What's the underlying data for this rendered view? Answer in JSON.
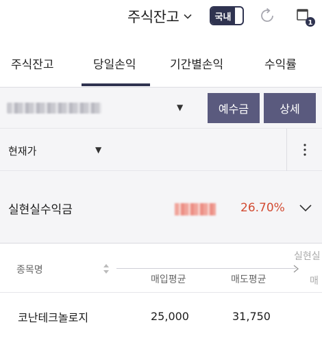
{
  "header": {
    "title": "주식잔고",
    "market_toggle": "국내",
    "badge_count": "1"
  },
  "tabs": [
    {
      "label": "주식잔고"
    },
    {
      "label": "당일손익"
    },
    {
      "label": "기간별손익"
    },
    {
      "label": "수익률"
    }
  ],
  "account": {
    "deposit_button": "예수금",
    "detail_button": "상세"
  },
  "price": {
    "label": "현재가"
  },
  "profit": {
    "label": "실현실수익금",
    "rate": "26.70%"
  },
  "table": {
    "headers": {
      "name": "종목명",
      "avg_buy": "매입평균",
      "avg_sell": "매도평균",
      "cut_top": "실현실",
      "cut_bottom": "매"
    },
    "rows": [
      {
        "name": "코난테크놀로지",
        "avg_buy": "25,000",
        "avg_sell": "31,750"
      }
    ]
  },
  "colors": {
    "accent": "#2f3350",
    "button": "#5a5a7e",
    "profit": "#d24b32",
    "panel": "#f5f5f7"
  }
}
